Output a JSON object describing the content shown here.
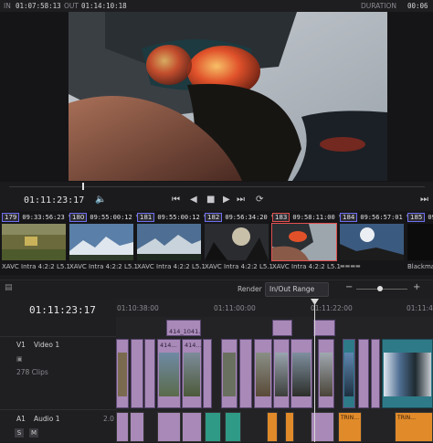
{
  "topbar": {
    "in_label": "IN",
    "in_tc": "01:07:58:13",
    "out_label": "OUT",
    "out_tc": "01:14:10:18",
    "duration_label": "DURATION",
    "duration_tc": "00:06"
  },
  "viewer": {
    "timecode": "01:11:23:17"
  },
  "transport": {
    "prev": "⏮",
    "back": "◀",
    "stop": "■",
    "play": "▶",
    "next": "⏭",
    "loop": "⟳",
    "volume": "🔈",
    "end": "⏭"
  },
  "clips": [
    {
      "num": "179",
      "tc": "09:33:56:23",
      "track": "V1",
      "name": "XAVC Intra 4:2:2 L5.1",
      "color": "#6e6ef0"
    },
    {
      "num": "180",
      "tc": "09:55:00:12",
      "track": "V1",
      "name": "XAVC Intra 4:2:2 L5.1",
      "color": "#6e6ef0"
    },
    {
      "num": "181",
      "tc": "09:55:00:12",
      "track": "V1",
      "name": "XAVC Intra 4:2:2 L5.1",
      "color": "#6e6ef0"
    },
    {
      "num": "182",
      "tc": "09:56:34:20",
      "track": "V1",
      "name": "XAVC Intra 4:2:2 L5.1",
      "color": "#6e6ef0"
    },
    {
      "num": "183",
      "tc": "09:58:11:00",
      "track": "V2",
      "name": "XAVC Intra 4:2:2 L5.1",
      "color": "#e05050"
    },
    {
      "num": "184",
      "tc": "09:56:57:01",
      "track": "V1",
      "name": "XAVC Intra 4:2:2 L5.1",
      "color": "#6e6ef0"
    },
    {
      "num": "185",
      "tc": "09",
      "track": "",
      "name": "Blackmagi",
      "color": "#6e6ef0"
    }
  ],
  "timeline": {
    "timecode": "01:11:23:17",
    "render_label": "Render",
    "render_option": "In/Out Range",
    "ruler_ticks": [
      "01:10:38:00",
      "01:11:00:00",
      "01:11:22:00",
      "01:11:44:0"
    ],
    "clip_label_1": "414_1041…",
    "clip_label_2": "414…",
    "v1_id": "V1",
    "v1_name": "Video 1",
    "v1_count": "278 Clips",
    "a1_id": "A1",
    "a1_name": "Audio 1",
    "a1_level": "2.0",
    "solo": "S",
    "mute": "M",
    "audio_label": "TRIN…"
  }
}
